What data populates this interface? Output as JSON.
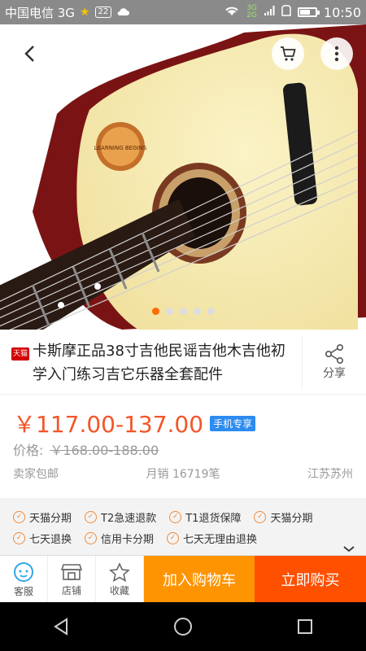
{
  "status_bar": {
    "carrier": "中国电信 3G",
    "sim_badge": "22",
    "network_types": [
      "3G",
      "2G"
    ],
    "time": "10:50"
  },
  "hero": {
    "gallery": {
      "count": 5,
      "active_index": 0
    },
    "stamp_text": "LEARNING BEGINS"
  },
  "product": {
    "store_badge": "天猫",
    "title": "卡斯摩正品38寸吉他民谣吉他木吉他初学入门练习吉它乐器全套配件",
    "share_label": "分享",
    "price": "￥117.00-137.00",
    "price_badge": "手机专享",
    "orig_label": "价格:",
    "orig_price": "￥168.00-188.00",
    "shipping": "卖家包邮",
    "monthly_sales": "月销 16719笔",
    "location": "江苏苏州",
    "accent_color": "#f3552a"
  },
  "services": {
    "line1": [
      "天猫分期",
      "T2急速退款",
      "T1退货保障",
      "天猫分期"
    ],
    "line2": [
      "七天退换",
      "信用卡分期",
      "七天无理由退换"
    ]
  },
  "bottom_bar": {
    "tabs": [
      {
        "label": "客服",
        "icon": "customer-service-icon"
      },
      {
        "label": "店铺",
        "icon": "store-icon"
      },
      {
        "label": "收藏",
        "icon": "star-icon"
      }
    ],
    "add_to_cart": "加入购物车",
    "buy_now": "立即购买"
  }
}
